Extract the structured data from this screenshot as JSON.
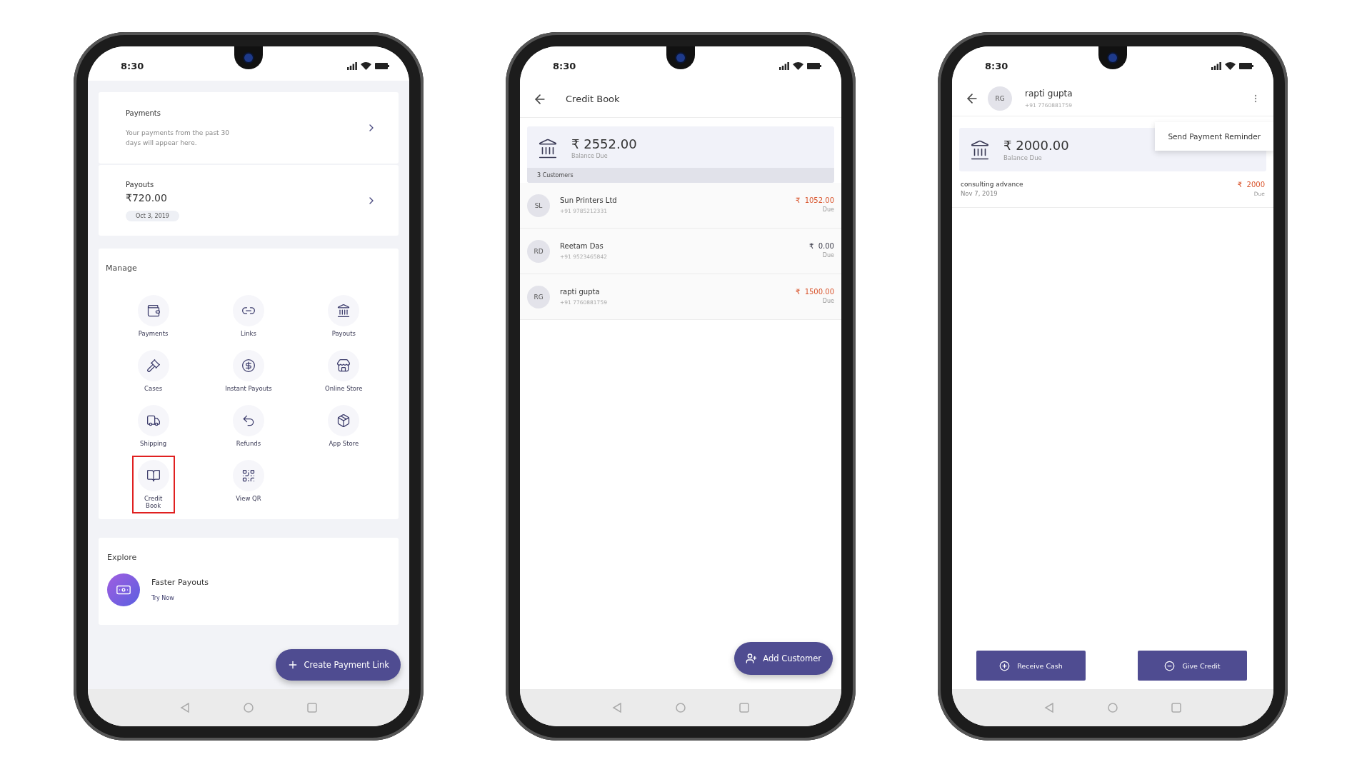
{
  "dashboard_screen": {
    "status_bar": {
      "time": "8:30"
    },
    "payments_card": {
      "title": "Payments",
      "text": "Your payments from the past 30 days will appear here."
    },
    "payouts_card": {
      "title": "Payouts",
      "amount": "₹720.00",
      "date": "Oct 3, 2019"
    },
    "manage": {
      "title": "Manage",
      "items": [
        {
          "label": "Payments",
          "selected": false
        },
        {
          "label": "Links",
          "selected": false
        },
        {
          "label": "Payouts",
          "selected": false
        },
        {
          "label": "Cases",
          "selected": false
        },
        {
          "label": "Instant Payouts",
          "selected": false
        },
        {
          "label": "Online Store",
          "selected": false
        },
        {
          "label": "Shipping",
          "selected": false
        },
        {
          "label": "Refunds",
          "selected": false
        },
        {
          "label": "App Store",
          "selected": false
        },
        {
          "label": "Credit Book",
          "selected": true
        },
        {
          "label": "View QR",
          "selected": false
        }
      ]
    },
    "explore": {
      "title": "Explore",
      "items": [
        {
          "title": "Faster Payouts",
          "action": "Try Now"
        }
      ]
    },
    "fab": {
      "label": "Create Payment Link"
    }
  },
  "credit_book_screen": {
    "status_bar": {
      "time": "8:30"
    },
    "title": "Credit Book",
    "balance": {
      "amount": "₹ 2552.00",
      "label": "Balance Due",
      "footer": "3 Customers"
    },
    "customers": [
      {
        "initials": "SL",
        "name": "Sun Printers Ltd",
        "phone": "+91 9785212331",
        "amount": "₹  1052.00",
        "status": "Due",
        "color": "#d9542c"
      },
      {
        "initials": "RD",
        "name": "Reetam Das",
        "phone": "+91 9523465842",
        "amount": "₹  0.00",
        "status": "Due",
        "color": "#3a3a48"
      },
      {
        "initials": "RG",
        "name": "rapti gupta",
        "phone": "+91 7760881759",
        "amount": "₹  1500.00",
        "status": "Due",
        "color": "#d9542c"
      }
    ],
    "fab": {
      "label": "Add Customer"
    }
  },
  "customer_screen": {
    "status_bar": {
      "time": "8:30"
    },
    "customer": {
      "initials": "RG",
      "name": "rapti gupta",
      "phone": "+91 7760881759"
    },
    "menu": {
      "items": [
        "Send Payment Reminder"
      ]
    },
    "balance": {
      "amount": "₹ 2000.00",
      "label": "Balance Due"
    },
    "transactions": [
      {
        "title": "consulting advance",
        "date": "Nov 7, 2019",
        "amount": "₹  2000",
        "status": "Due",
        "color": "#d9542c"
      }
    ],
    "buttons": [
      {
        "kind": "add",
        "label": "Receive Cash"
      },
      {
        "kind": "subtract",
        "label": "Give Credit"
      }
    ]
  }
}
